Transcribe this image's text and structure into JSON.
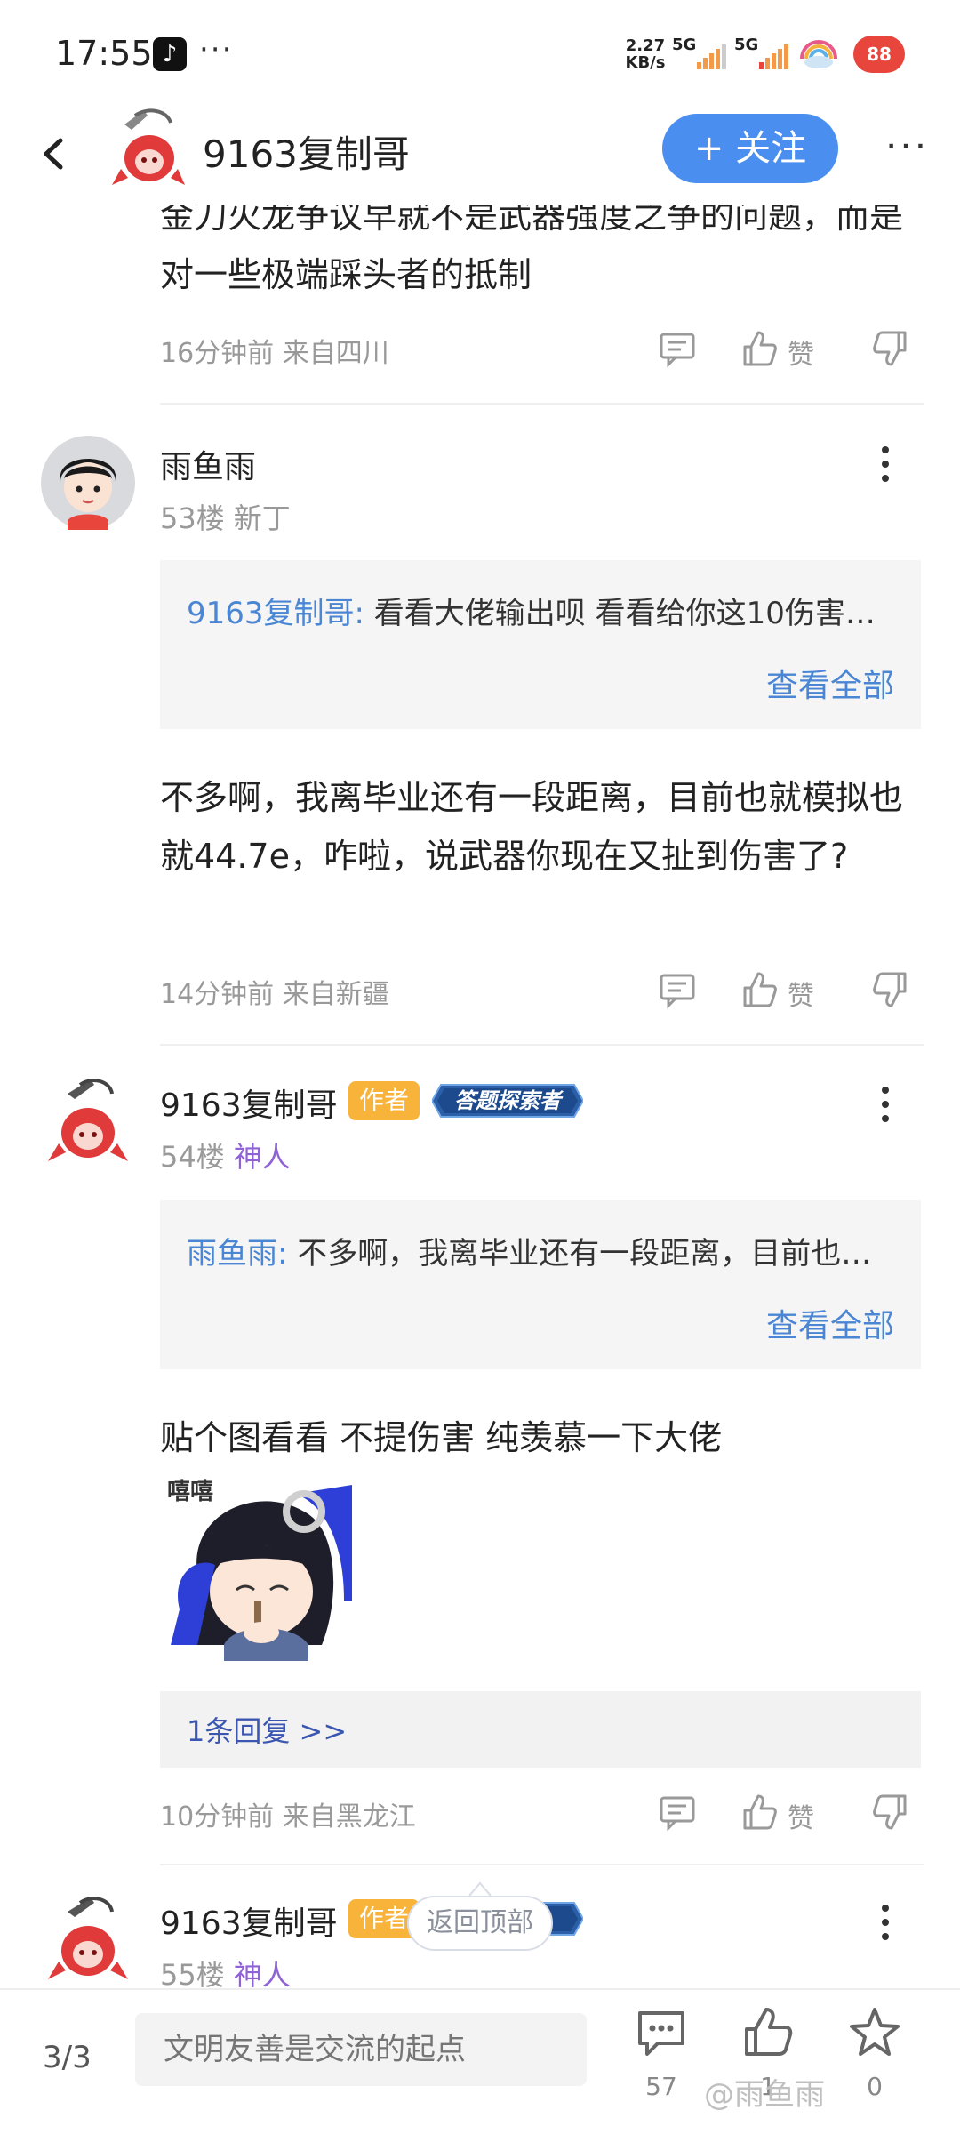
{
  "status_bar": {
    "time": "17:55",
    "more": "···",
    "net_speed_value": "2.27",
    "net_speed_unit": "KB/s",
    "sim1_label": "5G",
    "sim2_label": "5G",
    "battery": "88"
  },
  "header": {
    "title": "9163复制哥",
    "follow_label": "+ 关注",
    "more": "···"
  },
  "posts": [
    {
      "text": "金刀火龙争议早就不是武器强度之争的问题，而是对一些极端踩头者的抵制",
      "meta": "16分钟前 来自四川",
      "like_label": "赞"
    },
    {
      "user": "雨鱼雨",
      "floor": "53楼",
      "title_tag": "新丁",
      "quote_user": "9163复制哥:",
      "quote_text": " 看看大佬输出呗   看看给你这10伤害…",
      "quote_all": "查看全部",
      "text": "不多啊，我离毕业还有一段距离，目前也就模拟也就44.7e，咋啦，说武器你现在又扯到伤害了?",
      "meta": "14分钟前 来自新疆",
      "like_label": "赞"
    },
    {
      "user": "9163复制哥",
      "author_badge": "作者",
      "medal": "答题探索者",
      "floor": "54楼",
      "title_tag": "神人",
      "quote_user": "雨鱼雨:",
      "quote_text": " 不多啊，我离毕业还有一段距离，目前也…",
      "quote_all": "查看全部",
      "text": "贴个图看看   不提伤害   纯羡慕一下大佬",
      "sticker_caption": "嘻嘻",
      "reply_link": "1条回复 >>",
      "meta": "10分钟前 来自黑龙江",
      "like_label": "赞"
    },
    {
      "user": "9163复制哥",
      "author_badge": "作者",
      "floor": "55楼",
      "title_tag": "神人"
    }
  ],
  "back_to_top": "返回顶部",
  "bottom_bar": {
    "page": "3/3",
    "input_placeholder": "文明友善是交流的起点",
    "comments_count": "57",
    "likes_count": "1",
    "favorites_count": "0"
  },
  "watermark": "@雨鱼雨",
  "colors": {
    "accent_blue": "#4a8ff0",
    "link_blue": "#4a86d4",
    "author_badge": "#f7b33a",
    "title_purple": "#8f62d6"
  }
}
